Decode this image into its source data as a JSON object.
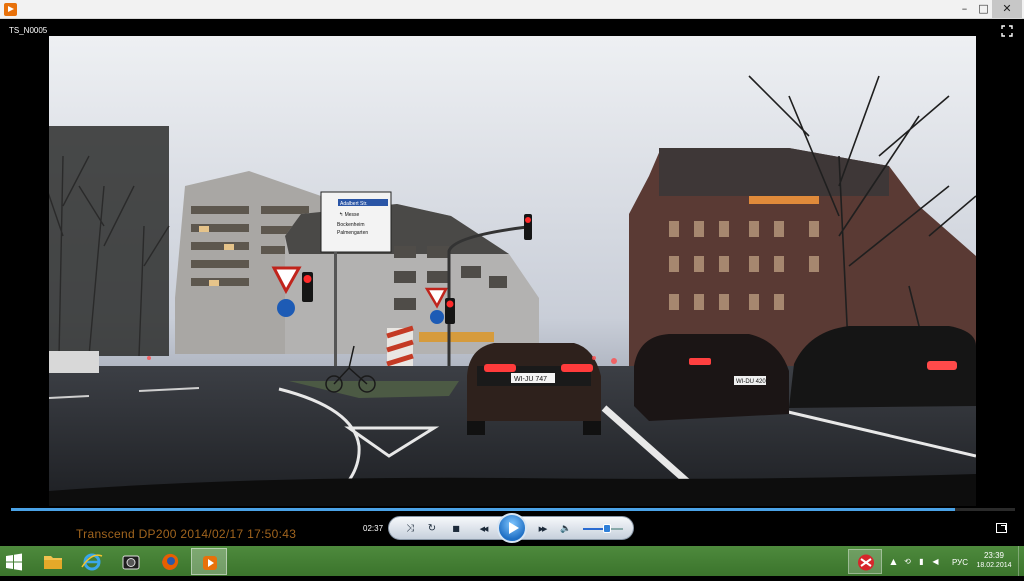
{
  "window": {
    "minimize_glyph": "–",
    "maximize_glyph": "□",
    "close_glyph": "✕"
  },
  "player": {
    "file_title": "TS_N0005",
    "watermark": "Transcend  DP200  2014/02/17  17:50:43",
    "elapsed": "02:37",
    "seek_progress": 0.94,
    "volume_level": 0.55,
    "accent_color": "#4aa2e6"
  },
  "video_scene": {
    "direction_sign": {
      "lines": [
        "Adalbert Str.",
        "↰ Messe",
        "Bockenheim",
        "Palmengarten"
      ]
    },
    "plates": [
      "WI-JU 747",
      "WI-DU 420"
    ]
  },
  "controls": {
    "shuffle_glyph": "⤨",
    "repeat_glyph": "↻",
    "stop_glyph": "■",
    "prev_glyph": "◀◀",
    "next_glyph": "▶▶",
    "volume_glyph": "🔈"
  },
  "taskbar": {
    "apps": [
      "file-explorer",
      "internet-explorer",
      "camera-app",
      "firefox",
      "media-player"
    ],
    "language": "РУС",
    "time": "23:39",
    "date": "18.02.2014"
  },
  "icons": {
    "start": "windows-logo-icon",
    "fullscreen": "fullscreen-icon",
    "miniplayer": "switch-to-library-icon"
  }
}
